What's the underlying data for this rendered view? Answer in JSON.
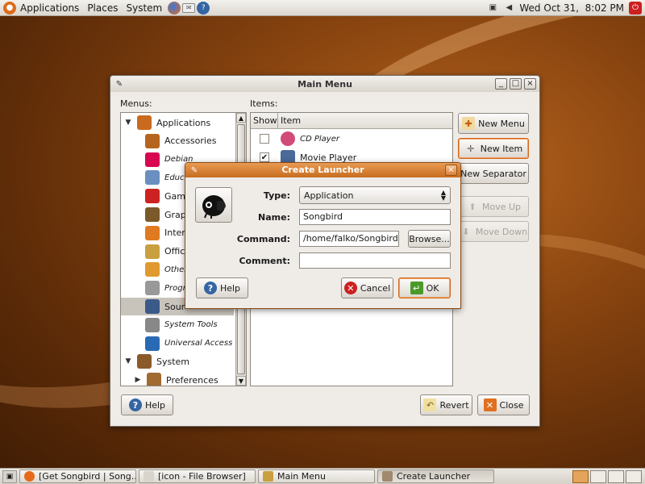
{
  "top_panel": {
    "menus": [
      "Applications",
      "Places",
      "System"
    ],
    "clock": "Wed Oct 31,  8:02 PM",
    "icons": [
      "ubuntu-logo",
      "firefox-icon",
      "mail-icon",
      "help-icon",
      "network-icon",
      "volume-icon",
      "power-icon"
    ]
  },
  "main_window": {
    "title": "Main Menu",
    "menus_label": "Menus:",
    "items_label": "Items:",
    "menus": [
      {
        "label": "Applications",
        "italic": false,
        "icon": "applications-icon",
        "color": "#c96a1e"
      },
      {
        "label": "Accessories",
        "italic": false,
        "icon": "accessories-icon",
        "color": "#b5651d"
      },
      {
        "label": "Debian",
        "italic": true,
        "icon": "debian-icon",
        "color": "#d70751"
      },
      {
        "label": "Educa",
        "italic": true,
        "icon": "education-icon",
        "color": "#6a8fc0"
      },
      {
        "label": "Gam",
        "italic": false,
        "icon": "games-icon",
        "color": "#cc2222"
      },
      {
        "label": "Grap",
        "italic": false,
        "icon": "graphics-icon",
        "color": "#7a5a2a"
      },
      {
        "label": "Inter",
        "italic": false,
        "icon": "internet-icon",
        "color": "#e07a20"
      },
      {
        "label": "Offic",
        "italic": false,
        "icon": "office-icon",
        "color": "#c9a040"
      },
      {
        "label": "Other",
        "italic": true,
        "icon": "other-icon",
        "color": "#e09a30"
      },
      {
        "label": "Progr",
        "italic": true,
        "icon": "programming-icon",
        "color": "#999999"
      },
      {
        "label": "Sour",
        "italic": false,
        "icon": "sound-video-icon",
        "color": "#3a5a8a"
      },
      {
        "label": "System Tools",
        "italic": true,
        "icon": "system-tools-icon",
        "color": "#888888"
      },
      {
        "label": "Universal Access",
        "italic": true,
        "icon": "universal-access-icon",
        "color": "#2a6ab5"
      },
      {
        "label": "System",
        "italic": false,
        "icon": "system-icon",
        "color": "#8a5a2a"
      },
      {
        "label": "Preferences",
        "italic": false,
        "icon": "preferences-icon",
        "color": "#a06a30"
      }
    ],
    "items_columns": {
      "show": "Show",
      "item": "Item"
    },
    "items": [
      {
        "label": "CD Player",
        "checked": false,
        "italic": true,
        "icon": "cd-player-icon"
      },
      {
        "label": "Movie Player",
        "checked": true,
        "italic": false,
        "icon": "movie-player-icon"
      }
    ],
    "buttons": {
      "new_menu": "New Menu",
      "new_item": "New Item",
      "new_separator": "New Separator",
      "move_up": "Move Up",
      "move_down": "Move Down",
      "help": "Help",
      "revert": "Revert",
      "close": "Close"
    }
  },
  "dialog": {
    "title": "Create Launcher",
    "type_label": "Type:",
    "type_value": "Application",
    "name_label": "Name:",
    "name_value": "Songbird",
    "command_label": "Command:",
    "command_value": "/home/falko/Songbird/sc",
    "comment_label": "Comment:",
    "comment_value": "",
    "browse": "Browse...",
    "help": "Help",
    "cancel": "Cancel",
    "ok": "OK"
  },
  "taskbar": {
    "tasks": [
      {
        "label": "[Get Songbird | Song...",
        "icon": "firefox-icon",
        "active": false
      },
      {
        "label": "[icon - File Browser]",
        "icon": "file-browser-icon",
        "active": false
      },
      {
        "label": "Main Menu",
        "icon": "main-menu-icon",
        "active": false
      },
      {
        "label": "Create Launcher",
        "icon": "launcher-icon",
        "active": true
      }
    ]
  },
  "colors": {
    "accent": "#d0661a",
    "title_active": "#c76d1f"
  }
}
